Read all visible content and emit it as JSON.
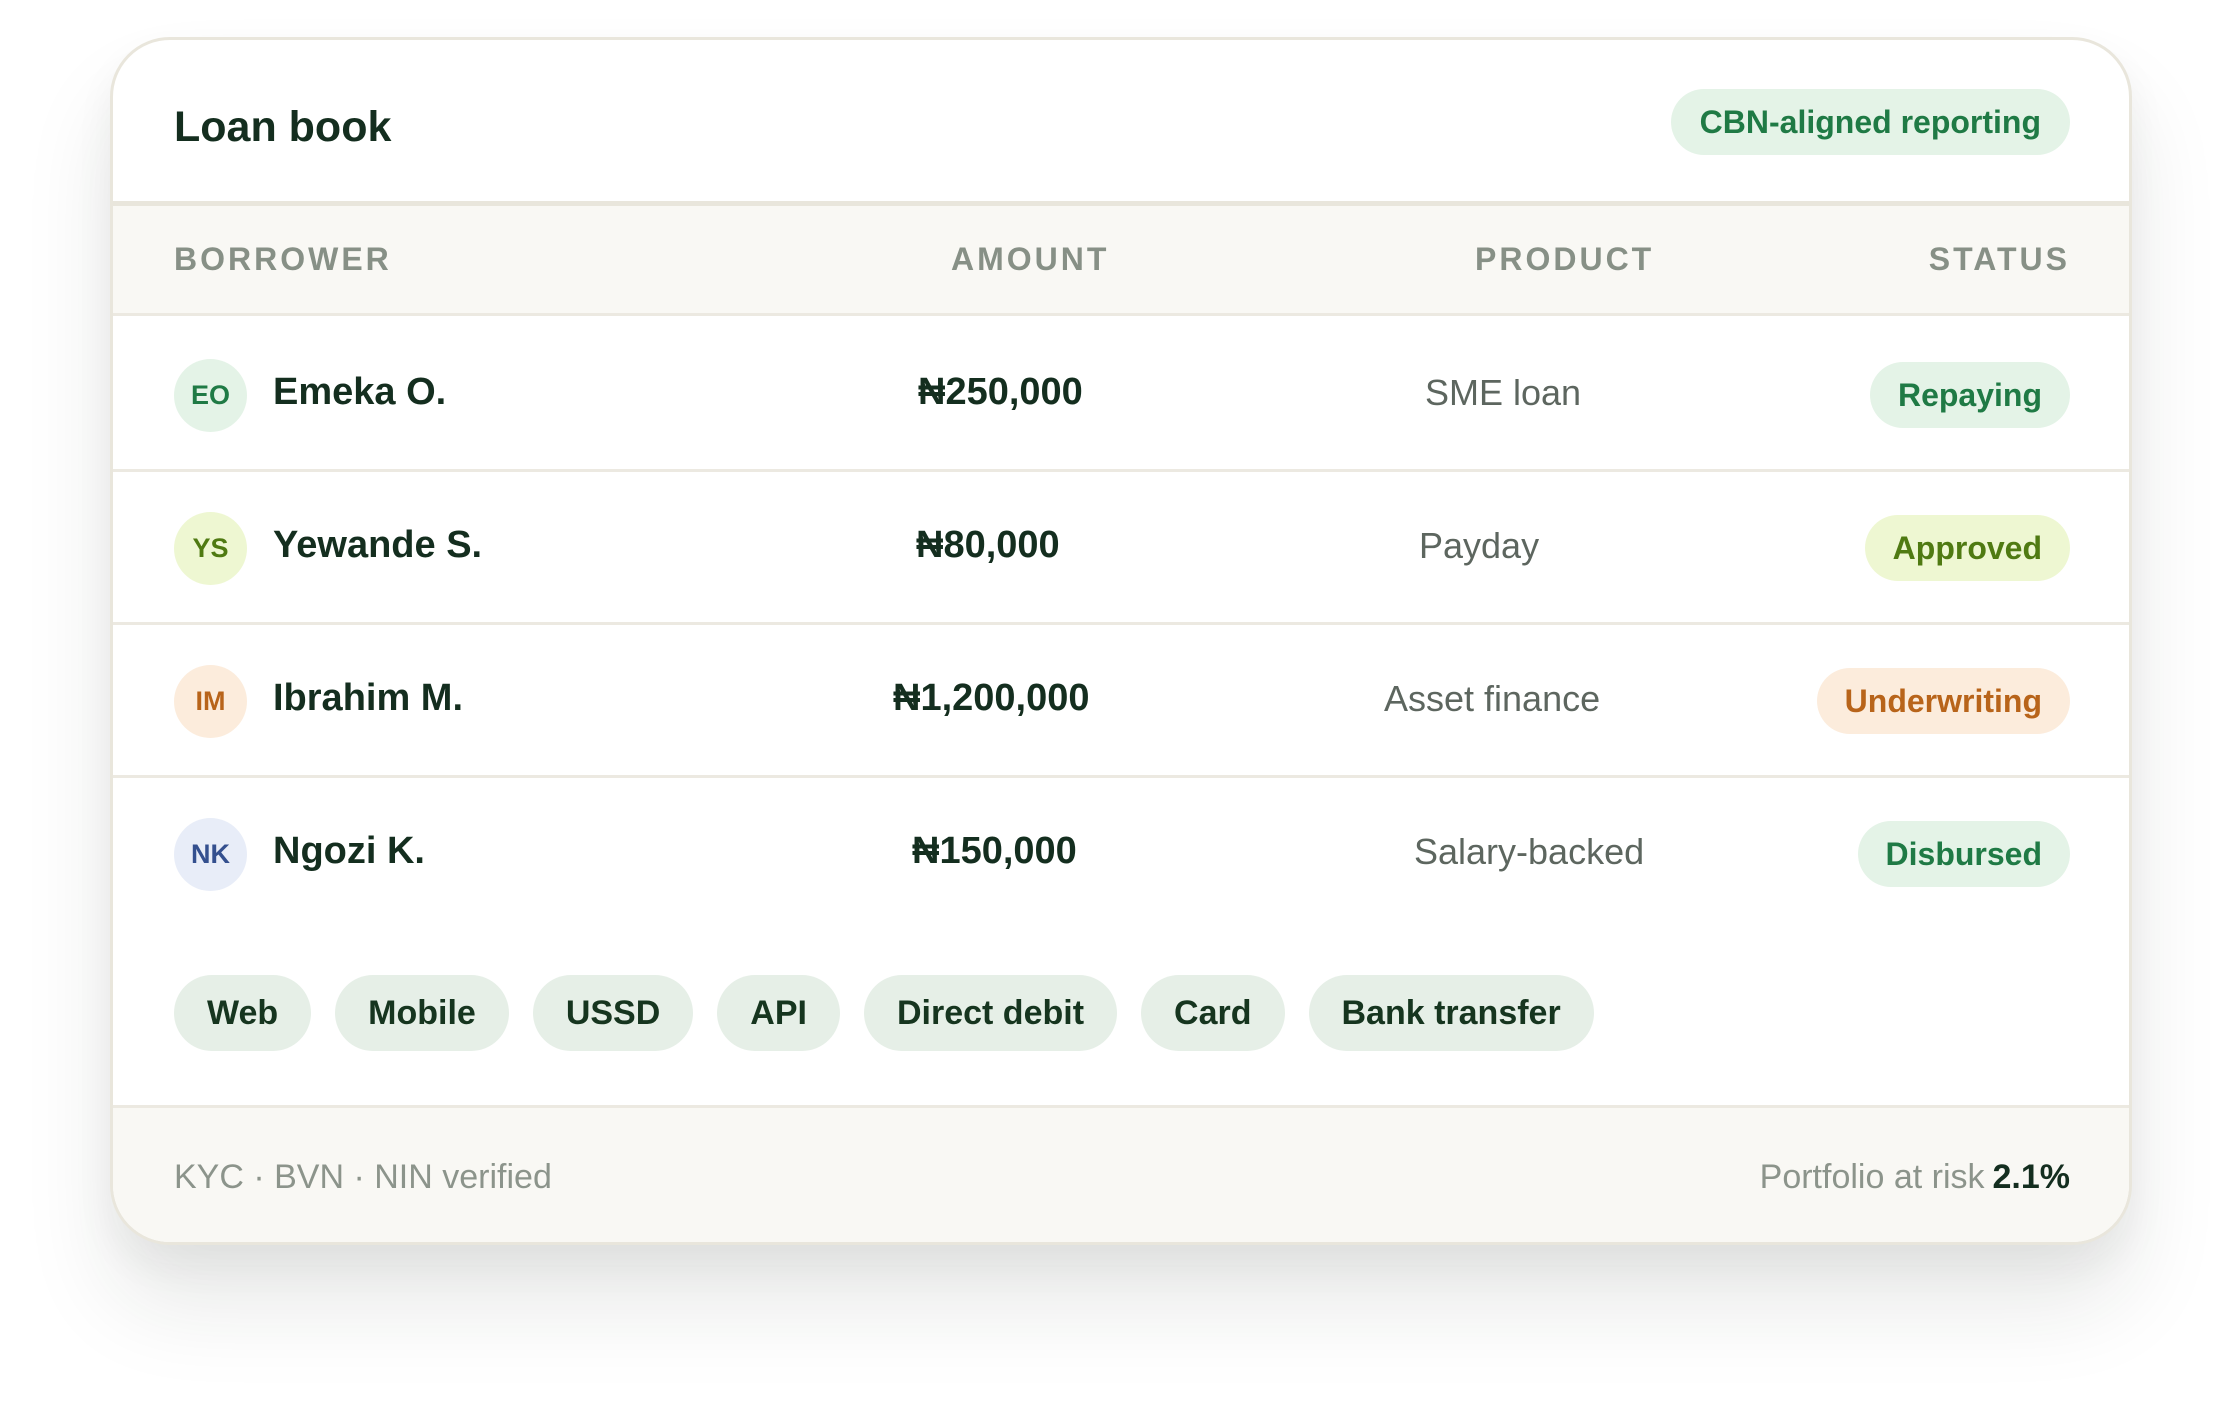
{
  "header": {
    "title": "Loan book",
    "badge": "CBN-aligned reporting"
  },
  "table": {
    "columns": [
      "BORROWER",
      "AMOUNT",
      "PRODUCT",
      "STATUS"
    ],
    "rows": [
      {
        "initials": "EO",
        "name": "Emeka O.",
        "amount": "₦250,000",
        "product": "SME loan",
        "status": "Repaying"
      },
      {
        "initials": "YS",
        "name": "Yewande S.",
        "amount": "₦80,000",
        "product": "Payday",
        "status": "Approved"
      },
      {
        "initials": "IM",
        "name": "Ibrahim M.",
        "amount": "₦1,200,000",
        "product": "Asset finance",
        "status": "Underwriting"
      },
      {
        "initials": "NK",
        "name": "Ngozi K.",
        "amount": "₦150,000",
        "product": "Salary-backed",
        "status": "Disbursed"
      }
    ]
  },
  "channels": [
    "Web",
    "Mobile",
    "USSD",
    "API",
    "Direct debit",
    "Card",
    "Bank transfer"
  ],
  "footer": {
    "verification": "KYC · BVN · NIN verified",
    "risk_label": "Portfolio at risk",
    "risk_value": "2.1%"
  },
  "colors": {
    "repaying": {
      "bg": "#e4f3e7",
      "fg": "#1f7a45"
    },
    "approved": {
      "bg": "#eef7d2",
      "fg": "#4f7a12"
    },
    "underwriting": {
      "bg": "#fcecdc",
      "fg": "#b8641a"
    },
    "disbursed": {
      "bg": "#e4f3e7",
      "fg": "#1f7a45"
    }
  }
}
